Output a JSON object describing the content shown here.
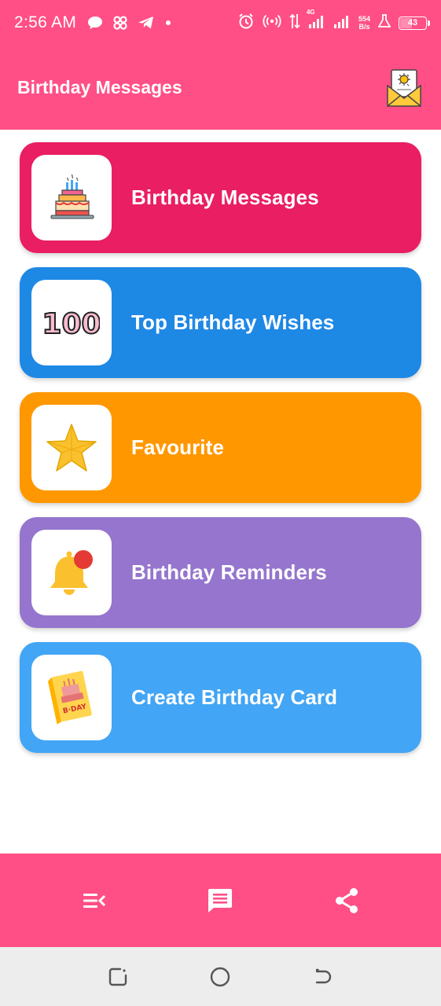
{
  "status_bar": {
    "time": "2:56 AM",
    "net_speed_value": "554",
    "net_speed_unit": "B/s",
    "network_type": "4G",
    "battery_level": "43",
    "icons": [
      "chat-bubble-icon",
      "pinwheel-icon",
      "telegram-icon",
      "dot-icon",
      "alarm-icon",
      "hotspot-icon",
      "data-arrows-icon",
      "signal-icon",
      "signal-icon",
      "lab-flask-icon",
      "battery-icon"
    ]
  },
  "app_bar": {
    "title": "Birthday Messages",
    "action_icon": "envelope-card-icon"
  },
  "menu": {
    "items": [
      {
        "label": "Birthday Messages",
        "icon": "birthday-cake-icon",
        "color": "#E91E63"
      },
      {
        "label": "Top Birthday Wishes",
        "icon": "hundred-icon",
        "color": "#1E88E5"
      },
      {
        "label": "Favourite",
        "icon": "star-icon",
        "color": "#FF9800"
      },
      {
        "label": "Birthday Reminders",
        "icon": "bell-notification-icon",
        "color": "#9575CD"
      },
      {
        "label": "Create Birthday Card",
        "icon": "bday-card-icon",
        "color": "#42A5F5"
      }
    ],
    "hundred_text": "100",
    "card_text": "B·DAY"
  },
  "bottom_bar": {
    "items": [
      "menu-icon",
      "message-icon",
      "share-icon"
    ]
  },
  "system_nav": {
    "items": [
      "recents-icon",
      "home-icon",
      "back-icon"
    ]
  },
  "colors": {
    "primary": "#FF4F86",
    "system_nav_bg": "#EDEDED"
  }
}
